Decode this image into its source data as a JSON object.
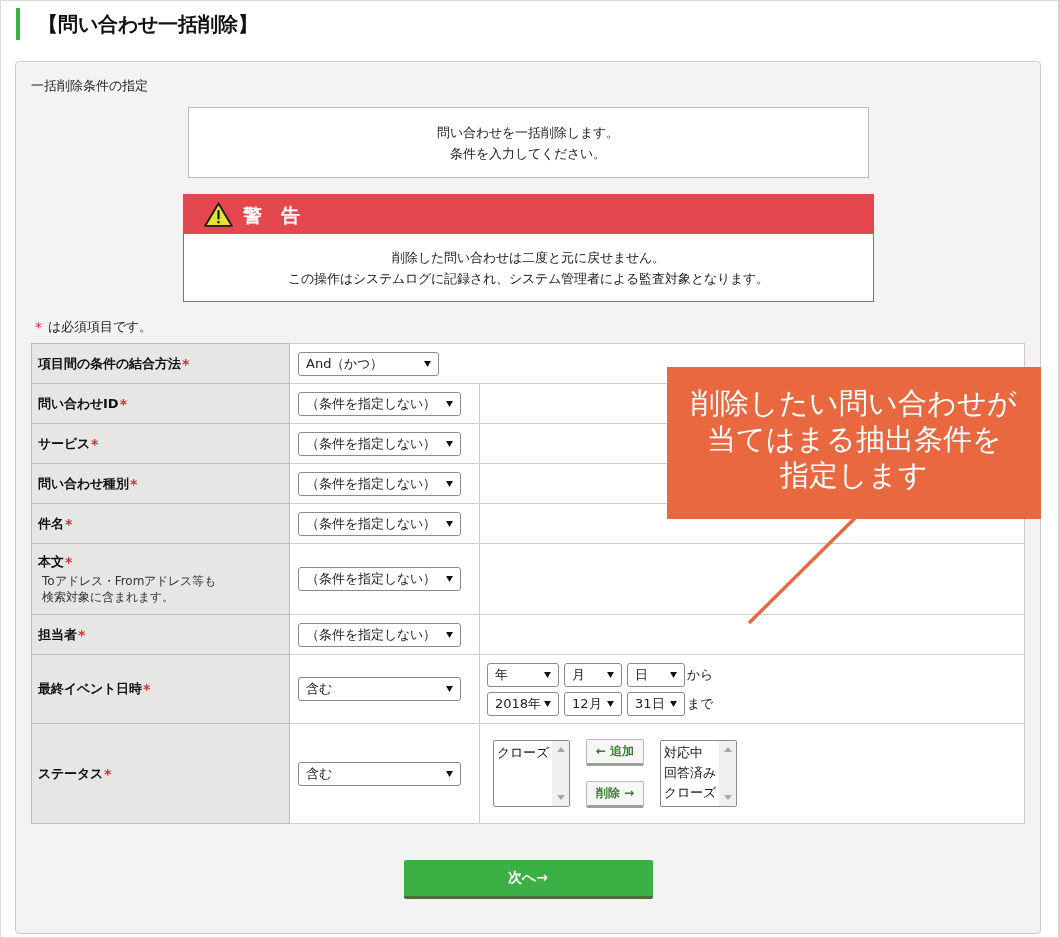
{
  "page_title": "【問い合わせ一括削除】",
  "section_label": "一括削除条件の指定",
  "info_box": {
    "lines": [
      "問い合わせを一括削除します。",
      "条件を入力してください。"
    ]
  },
  "warning": {
    "title": "警　告",
    "lines": [
      "削除した問い合わせは二度と元に戻せません。",
      "この操作はシステムログに記録され、システム管理者による監査対象となります。"
    ]
  },
  "required_note": {
    "mark": "*",
    "text": "は必須項目です。"
  },
  "conditions": [
    {
      "kind": "combine",
      "label": "項目間の条件の結合方法",
      "required_mark": "*",
      "operator": "And（かつ）"
    },
    {
      "kind": "select",
      "label": "問い合わせID",
      "required_mark": "*",
      "operator": "（条件を指定しない）"
    },
    {
      "kind": "select",
      "label": "サービス",
      "required_mark": "*",
      "operator": "（条件を指定しない）"
    },
    {
      "kind": "select",
      "label": "問い合わせ種別",
      "required_mark": "*",
      "operator": "（条件を指定しない）"
    },
    {
      "kind": "select",
      "label": "件名",
      "required_mark": "*",
      "operator": "（条件を指定しない）"
    },
    {
      "kind": "select",
      "label": "本文",
      "required_mark": "*",
      "note_lines": [
        "Toアドレス・Fromアドレス等も",
        "検索対象に含まれます。"
      ],
      "operator": "（条件を指定しない）"
    },
    {
      "kind": "select",
      "label": "担当者",
      "required_mark": "*",
      "operator": "（条件を指定しない）"
    },
    {
      "kind": "date_range",
      "label": "最終イベント日時",
      "required_mark": "*",
      "operator": "含む",
      "from": {
        "year": "年",
        "month": "月",
        "day": "日",
        "suffix": "から"
      },
      "to": {
        "year": "2018年",
        "month": "12月",
        "day": "31日",
        "suffix": "まで"
      }
    },
    {
      "kind": "status",
      "label": "ステータス",
      "required_mark": "*",
      "operator": "含む",
      "left_list": [
        {
          "label": "クローズ",
          "selected": false
        }
      ],
      "add_button": "← 追加",
      "remove_button": "削除 →",
      "right_list": [
        {
          "label": "対応中",
          "selected": false
        },
        {
          "label": "回答済み",
          "selected": false
        },
        {
          "label": "クローズ",
          "selected": false
        }
      ]
    }
  ],
  "next_button": "次へ→",
  "callout": {
    "lines": [
      "削除したい問い合わせが",
      "当てはまる抽出条件を",
      "指定します"
    ]
  }
}
